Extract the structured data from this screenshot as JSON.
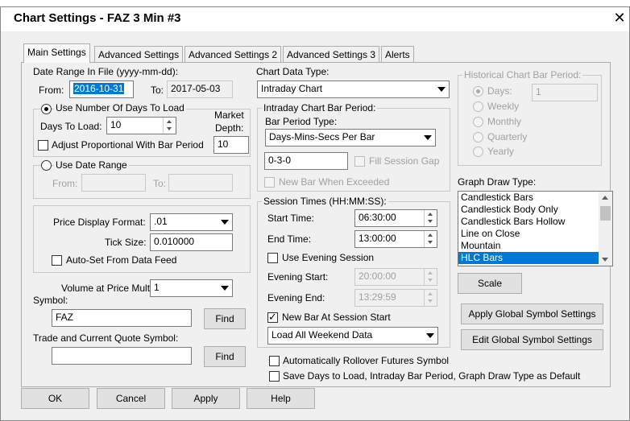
{
  "window": {
    "title": "Chart Settings - FAZ  3 Min   #3",
    "close_glyph": "✕"
  },
  "tabs": [
    {
      "label": "Main Settings"
    },
    {
      "label": "Advanced Settings"
    },
    {
      "label": "Advanced Settings 2"
    },
    {
      "label": "Advanced Settings 3"
    },
    {
      "label": "Alerts"
    }
  ],
  "date_range": {
    "label": "Date Range In File (yyyy-mm-dd):",
    "from_label": "From:",
    "from_value": "2016-10-31",
    "to_label": "To:",
    "to_value": "2017-05-03"
  },
  "days_group": {
    "radio_label": "Use Number Of Days To Load",
    "days_label": "Days To Load:",
    "days_value": "10",
    "market_depth_label_1": "Market",
    "market_depth_label_2": "Depth:",
    "market_depth_value": "10",
    "adjust_label": "Adjust Proportional With Bar Period"
  },
  "date_range_group": {
    "radio_label": "Use Date Range",
    "from_label": "From:",
    "to_label": "To:"
  },
  "price_group": {
    "format_label": "Price Display Format:",
    "format_value": ".01",
    "tick_label": "Tick Size:",
    "tick_value": "0.010000",
    "autoset_label": "Auto-Set From Data Feed"
  },
  "volume": {
    "label": "Volume at Price Mult.:",
    "value": "1"
  },
  "symbol": {
    "label": "Symbol:",
    "value": "FAZ",
    "find_label": "Find"
  },
  "trade_symbol": {
    "label": "Trade and Current Quote Symbol:",
    "value": "",
    "find_label": "Find"
  },
  "chart_data_type": {
    "label": "Chart Data Type:",
    "value": "Intraday Chart"
  },
  "intraday_period": {
    "group_label": "Intraday Chart Bar Period:",
    "type_label": "Bar Period Type:",
    "type_value": "Days-Mins-Secs Per Bar",
    "value": "0-3-0",
    "fill_gap_label": "Fill Session Gap",
    "new_bar_exceeded_label": "New Bar When Exceeded"
  },
  "session": {
    "group_label": "Session Times (HH:MM:SS):",
    "start_label": "Start Time:",
    "start_value": "06:30:00",
    "end_label": "End Time:",
    "end_value": "13:00:00",
    "evening_label": "Use Evening Session",
    "evening_start_label": "Evening Start:",
    "evening_start_value": "20:00:00",
    "evening_end_label": "Evening End:",
    "evening_end_value": "13:29:59",
    "new_bar_label": "New Bar At Session Start",
    "weekend_value": "Load All Weekend Data"
  },
  "options": {
    "rollover_label": "Automatically Rollover Futures Symbol",
    "save_defaults_label": "Save Days to Load, Intraday Bar Period, Graph Draw Type as Default"
  },
  "historical": {
    "group_label": "Historical Chart Bar Period:",
    "days_label": "Days:",
    "days_value": "1",
    "weekly_label": "Weekly",
    "monthly_label": "Monthly",
    "quarterly_label": "Quarterly",
    "yearly_label": "Yearly"
  },
  "graph_draw": {
    "label": "Graph Draw Type:",
    "items": [
      "Candlestick Bars",
      "Candlestick Body Only",
      "Candlestick Bars Hollow",
      "Line on Close",
      "Mountain",
      "HLC Bars"
    ],
    "selected": "HLC Bars",
    "scale_label": "Scale"
  },
  "global": {
    "apply_label": "Apply Global Symbol Settings",
    "edit_label": "Edit Global Symbol Settings"
  },
  "footer": {
    "ok": "OK",
    "cancel": "Cancel",
    "apply": "Apply",
    "help": "Help"
  }
}
